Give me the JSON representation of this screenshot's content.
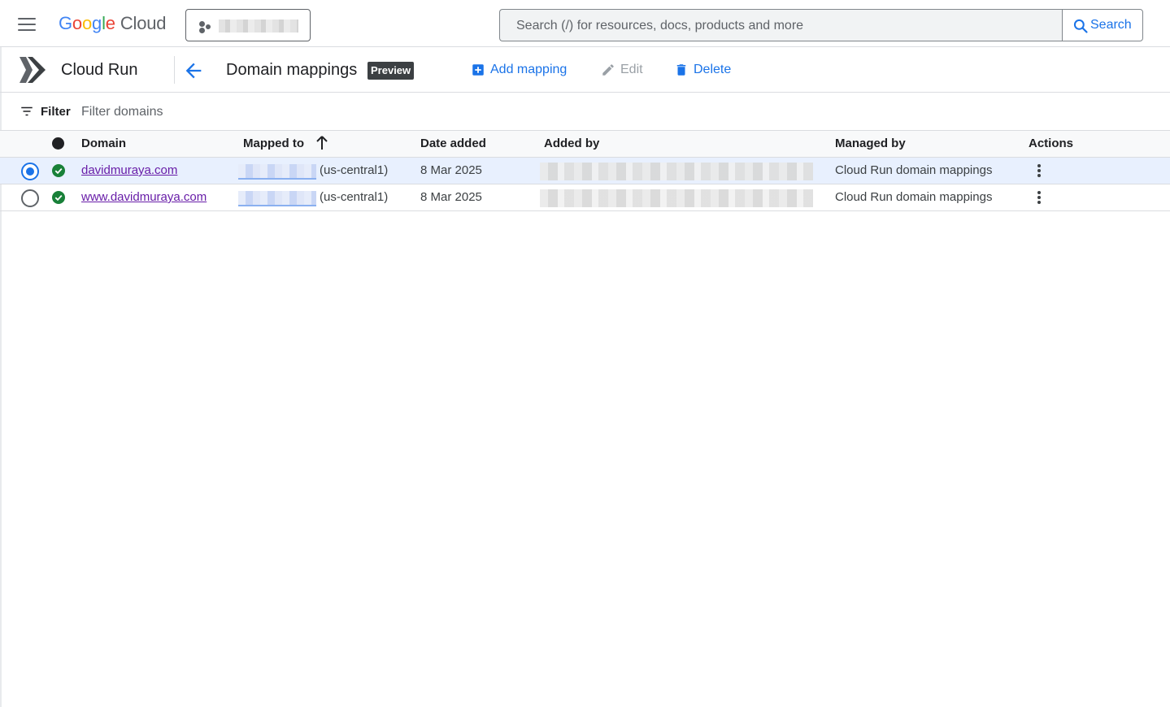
{
  "header": {
    "logo": {
      "google": "Google",
      "cloud": "Cloud"
    },
    "search": {
      "placeholder": "Search (/) for resources, docs, products and more",
      "button_label": "Search"
    }
  },
  "subheader": {
    "product_name": "Cloud Run",
    "page_title": "Domain mappings",
    "badge": "Preview",
    "actions": {
      "add": "Add mapping",
      "edit": "Edit",
      "delete": "Delete"
    }
  },
  "filter": {
    "label": "Filter",
    "placeholder": "Filter domains"
  },
  "table": {
    "columns": {
      "domain": "Domain",
      "mapped_to": "Mapped to",
      "date_added": "Date added",
      "added_by": "Added by",
      "managed_by": "Managed by",
      "actions": "Actions"
    },
    "rows": [
      {
        "selected": true,
        "status": "ok",
        "domain": "davidmuraya.com",
        "mapped_region": "(us-central1)",
        "date_added": "8 Mar 2025",
        "managed_by": "Cloud Run domain mappings"
      },
      {
        "selected": false,
        "status": "ok",
        "domain": "www.davidmuraya.com",
        "mapped_region": "(us-central1)",
        "date_added": "8 Mar 2025",
        "managed_by": "Cloud Run domain mappings"
      }
    ]
  },
  "colors": {
    "accent": "#1a73e8",
    "status_ok": "#188038",
    "link_visited": "#681da8",
    "selected_row": "#e8f0fe"
  }
}
